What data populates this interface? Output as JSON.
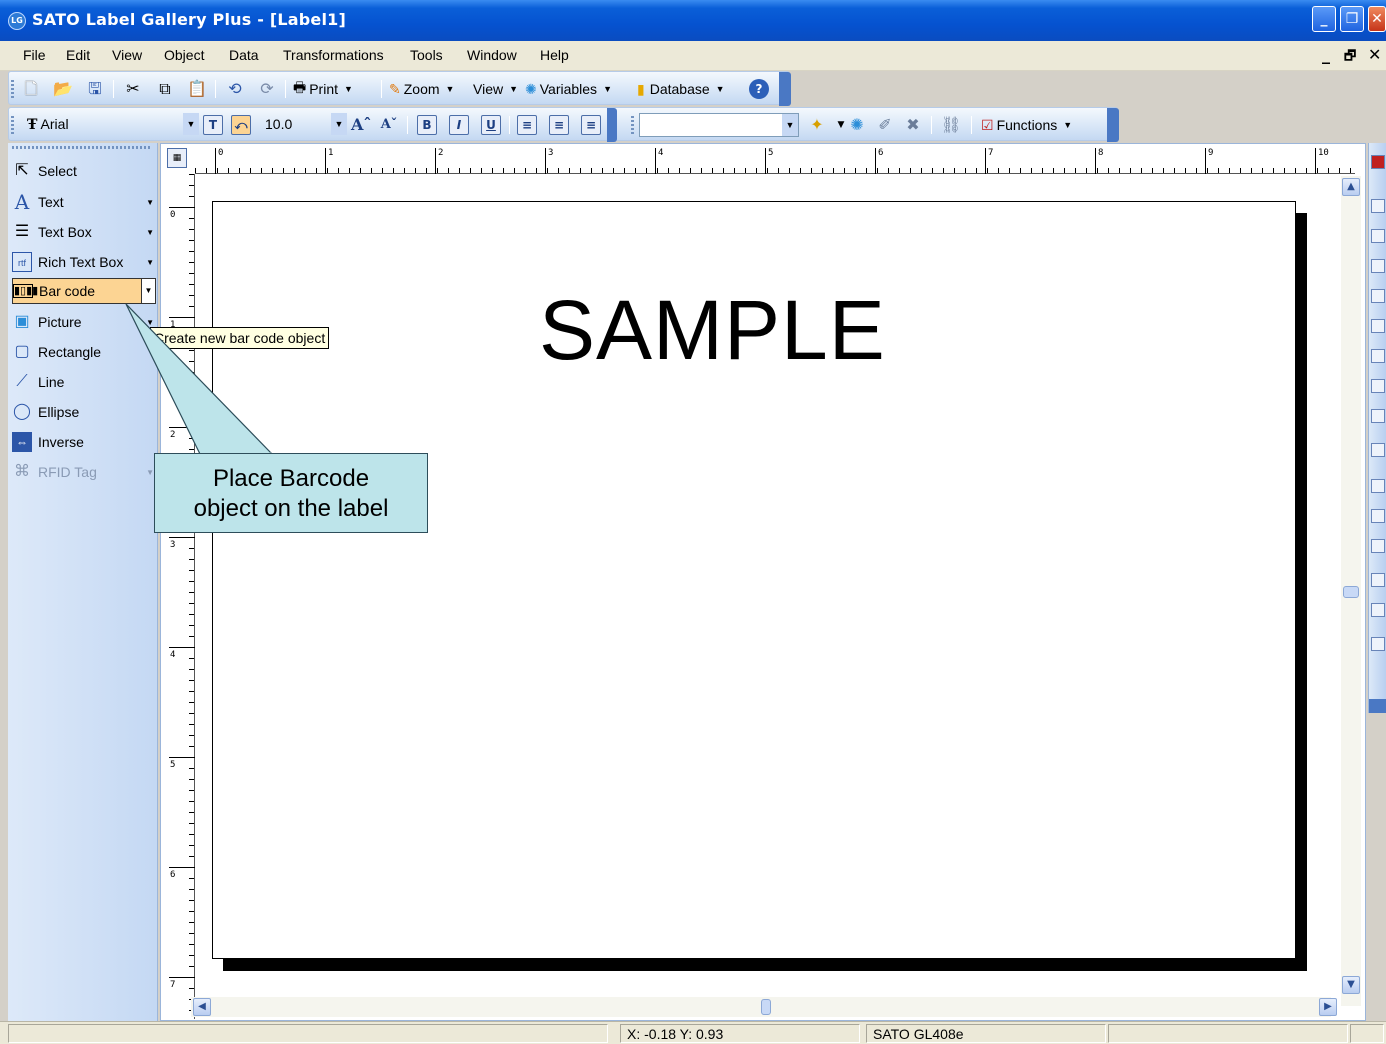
{
  "window": {
    "title": "SATO Label Gallery Plus - [Label1]",
    "app_icon_text": "LG",
    "controls": {
      "minimize": "_",
      "restore": "❐",
      "close": "✕"
    }
  },
  "menu": {
    "items": [
      "File",
      "Edit",
      "View",
      "Object",
      "Data",
      "Transformations",
      "Tools",
      "Window",
      "Help"
    ],
    "mdi_controls": [
      "_",
      "🗗",
      "✕"
    ]
  },
  "toolbar1": {
    "print_label": "Print",
    "zoom_label": "Zoom",
    "view_label": "View",
    "variables_label": "Variables",
    "database_label": "Database"
  },
  "toolbar2": {
    "font_name": "Arial",
    "font_size": "10.0",
    "functions_label": "Functions",
    "format_buttons": [
      "B",
      "I",
      "U"
    ]
  },
  "tools": {
    "items": [
      {
        "label": "Select",
        "icon": "pointer-icon"
      },
      {
        "label": "Text",
        "icon": "text-icon"
      },
      {
        "label": "Text Box",
        "icon": "text-box-icon"
      },
      {
        "label": "Rich Text Box",
        "icon": "rich-text-icon"
      },
      {
        "label": "Bar code",
        "icon": "barcode-icon"
      },
      {
        "label": "Picture",
        "icon": "picture-icon"
      },
      {
        "label": "Rectangle",
        "icon": "rectangle-icon"
      },
      {
        "label": "Line",
        "icon": "line-icon"
      },
      {
        "label": "Ellipse",
        "icon": "ellipse-icon"
      },
      {
        "label": "Inverse",
        "icon": "inverse-icon"
      },
      {
        "label": "RFID Tag",
        "icon": "rfid-icon"
      }
    ]
  },
  "ruler": {
    "h_labels": [
      "0",
      "1",
      "2",
      "3",
      "4",
      "5",
      "6",
      "7",
      "8",
      "9",
      "10"
    ],
    "v_labels": [
      "0",
      "1",
      "2",
      "3",
      "4",
      "5",
      "6",
      "7"
    ]
  },
  "label": {
    "text": "SAMPLE"
  },
  "tooltip": {
    "text": "Create new bar code object"
  },
  "callout": {
    "line1": "Place Barcode",
    "line2": "object on the label"
  },
  "status": {
    "coords": "X: -0.18 Y:  0.93",
    "printer": "SATO GL408e"
  },
  "colors": {
    "titlebar": "#0552d0",
    "active_tool": "#fcd493",
    "callout_fill": "#bde4ea",
    "tooltip_fill": "#ffffe1"
  }
}
